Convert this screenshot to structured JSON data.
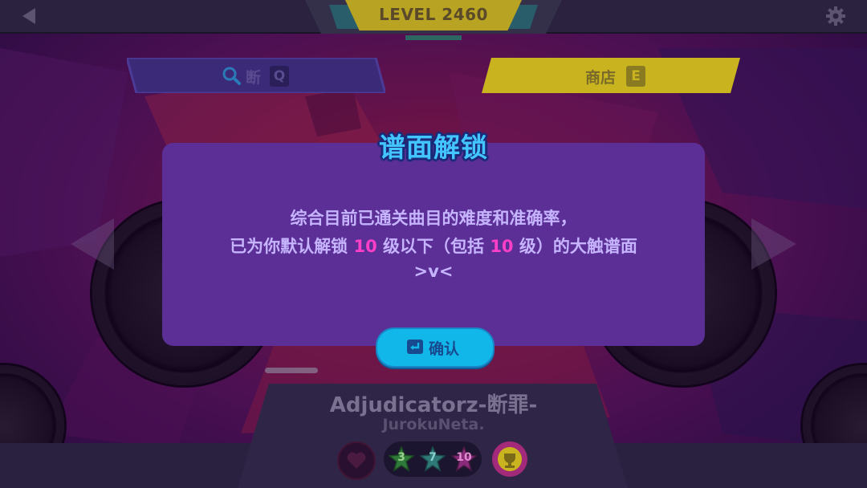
{
  "header": {
    "level_text": "LEVEL  2460"
  },
  "tabs": {
    "search_label": "断",
    "search_key": "Q",
    "shop_label": "商店",
    "shop_key": "E"
  },
  "song": {
    "title": "Adjudicatorz-断罪-",
    "artist": "JurokuNeta."
  },
  "difficulties": [
    {
      "level": "3",
      "color": "#2f7a3a"
    },
    {
      "level": "7",
      "color": "#2f7a78"
    },
    {
      "level": "10",
      "color": "#8a2a7a"
    }
  ],
  "dialog": {
    "title": "谱面解锁",
    "line1": "综合目前已通关曲目的难度和准确率，",
    "line2_prefix": "已为你默认解锁 ",
    "line2_num1": "10",
    "line2_mid": " 级以下（包括 ",
    "line2_num2": "10",
    "line2_suffix": " 级）的大触谱面",
    "line3": ">v<",
    "confirm_label": "确认"
  },
  "colors": {
    "dialog_bg": "#5b2f96",
    "title_color": "#43c6ff",
    "highlight": "#ff3fc7",
    "confirm_bg": "#12b7ea",
    "shop_tab": "#c9b41f",
    "search_tab": "#3a2a78"
  },
  "icons": {
    "back": "back-arrow-icon",
    "settings": "gear-icon",
    "search": "magnifier-icon",
    "confirm": "enter-key-icon",
    "favorite": "heart-icon",
    "rank": "trophy-icon"
  }
}
